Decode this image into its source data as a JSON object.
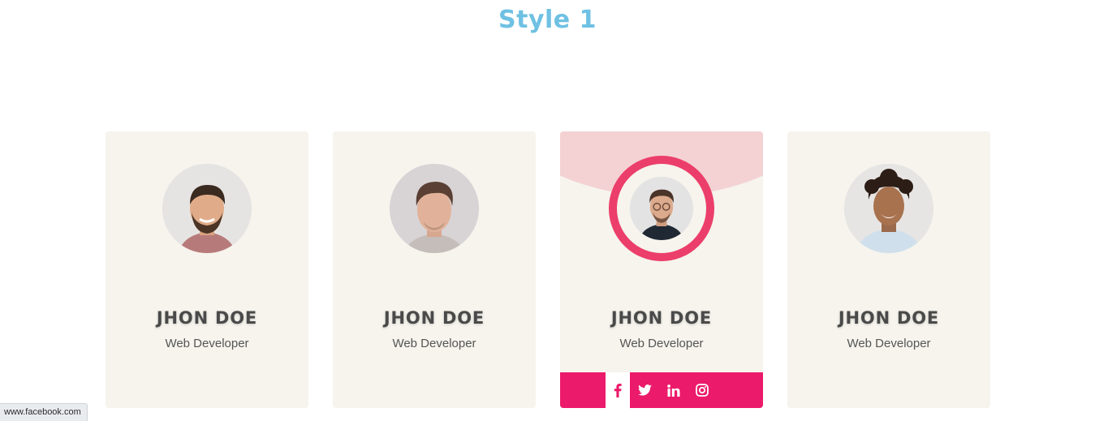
{
  "page": {
    "title": "Style 1"
  },
  "colors": {
    "title": "#6fc1e3",
    "ring": "#ec3e6b",
    "social_bar": "#ec1a6a",
    "card_bg": "#f6f4ed"
  },
  "cards": [
    {
      "name": "JHON DOE",
      "role": "Web Developer",
      "avatar": "avatar-man-beard-smiling",
      "active": false
    },
    {
      "name": "JHON DOE",
      "role": "Web Developer",
      "avatar": "avatar-man-neutral",
      "active": false
    },
    {
      "name": "JHON DOE",
      "role": "Web Developer",
      "avatar": "avatar-man-glasses",
      "active": true,
      "social": [
        "facebook-icon",
        "twitter-icon",
        "linkedin-icon",
        "instagram-icon"
      ]
    },
    {
      "name": "JHON DOE",
      "role": "Web Developer",
      "avatar": "avatar-man-curly-hair",
      "active": false
    }
  ],
  "status_bar": {
    "url": "www.facebook.com"
  }
}
